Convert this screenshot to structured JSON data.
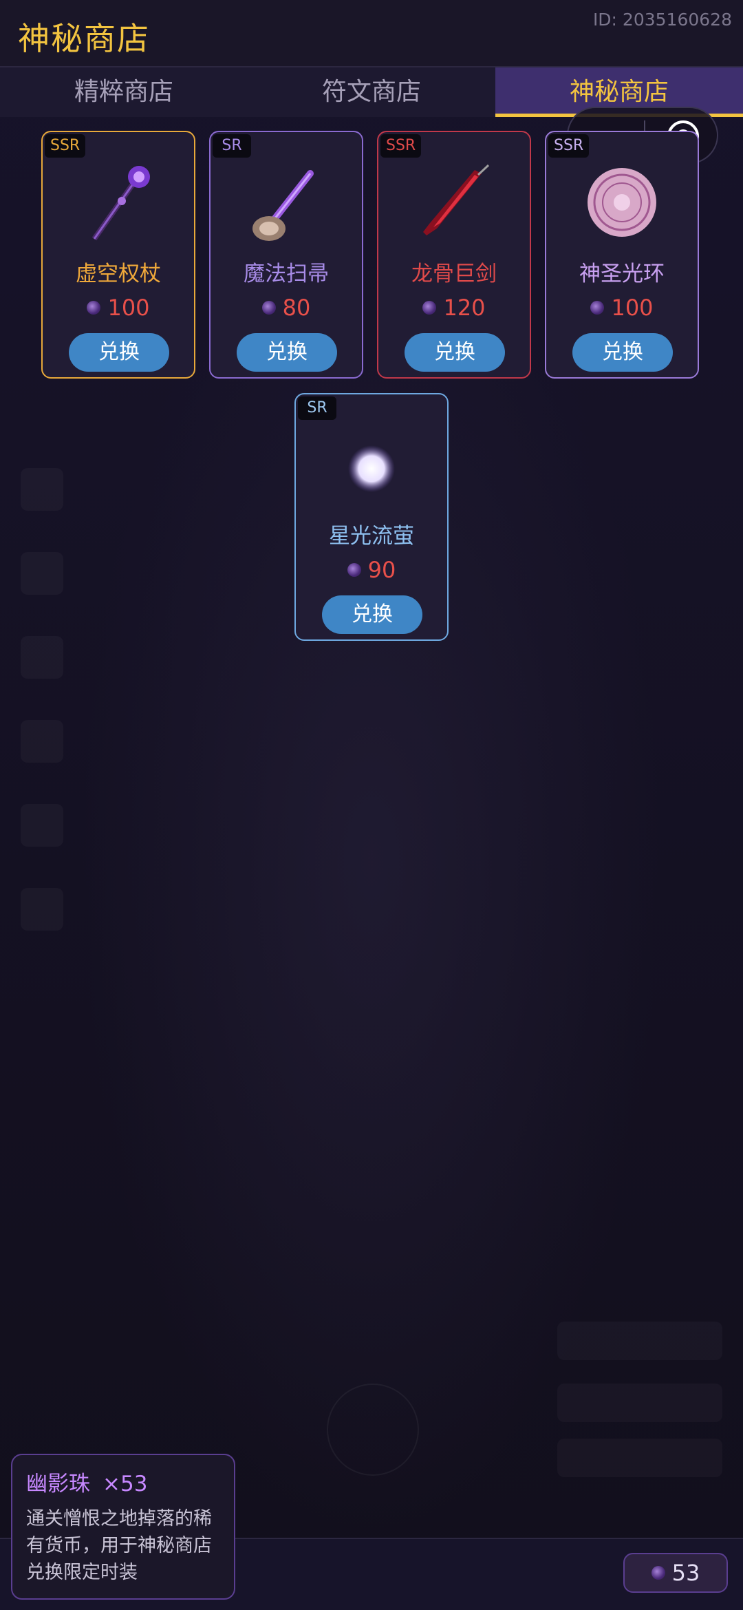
{
  "header": {
    "title": "神秘商店",
    "user_id": "ID: 2035160628"
  },
  "tabs": [
    {
      "label": "精粹商店",
      "active": false
    },
    {
      "label": "符文商店",
      "active": false
    },
    {
      "label": "神秘商店",
      "active": true
    }
  ],
  "items": [
    {
      "rarity": "SSR",
      "name": "虚空权杖",
      "price": "100",
      "button": "兑换",
      "icon": "void-scepter-icon",
      "color": "#e8a93a"
    },
    {
      "rarity": "SR",
      "name": "魔法扫帚",
      "price": "80",
      "button": "兑换",
      "icon": "magic-broom-icon",
      "color": "#9e7ce0"
    },
    {
      "rarity": "SSR",
      "name": "龙骨巨剑",
      "price": "120",
      "button": "兑换",
      "icon": "dragonbone-sword-icon",
      "color": "#d64048"
    },
    {
      "rarity": "SSR",
      "name": "神圣光环",
      "price": "100",
      "button": "兑换",
      "icon": "holy-halo-icon",
      "color": "#b88ae6"
    },
    {
      "rarity": "SR",
      "name": "星光流萤",
      "price": "90",
      "button": "兑换",
      "icon": "starlight-firefly-icon",
      "color": "#6ea8e0"
    }
  ],
  "tooltip": {
    "name": "幽影珠",
    "count": "×53",
    "description": "通关憎恨之地掉落的稀有货币，用于神秘商店兑换限定时装"
  },
  "balance": "53",
  "colors": {
    "accent": "#f3c440",
    "price": "#e8504a",
    "button": "#3f86c6"
  }
}
